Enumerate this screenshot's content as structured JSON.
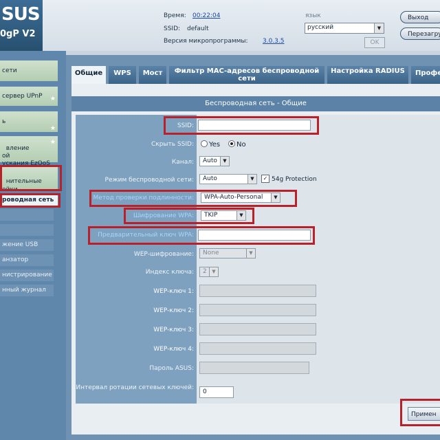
{
  "header": {
    "logo_text": "SUS",
    "model": "0gP V2",
    "time_label": "Время:",
    "time_value": "00:22:04",
    "ssid_label": "SSID:",
    "ssid_value": "default",
    "firmware_label": "Версия микропрограммы:",
    "firmware_value": "3.0.3.5",
    "language_label": "язык",
    "language_value": "русский",
    "ok_label": "OK",
    "logout_label": "Выход",
    "reboot_label": "Перезагрузка"
  },
  "nav": {
    "items": [
      {
        "label": "сети"
      },
      {
        "label": "сервер UPnP"
      },
      {
        "label": "ь"
      },
      {
        "label": "вление\nой\nускания EzQoS"
      },
      {
        "label": "нительные\nойки"
      },
      {
        "label": "роводная сеть"
      }
    ],
    "subitems": [
      {
        "label": "жение USB"
      },
      {
        "label": "анзатор"
      },
      {
        "label": "нистрирование"
      },
      {
        "label": "нный журнал"
      }
    ]
  },
  "tabs": [
    {
      "label": "Общие"
    },
    {
      "label": "WPS"
    },
    {
      "label": "Мост"
    },
    {
      "label": "Фильтр MAC-адресов беспроводной сети"
    },
    {
      "label": "Настройка RADIUS"
    },
    {
      "label": "Профе"
    }
  ],
  "panel": {
    "title": "Беспроводная сеть - Общие",
    "ssid_label": "SSID:",
    "ssid_value": "",
    "hide_ssid_label": "Скрыть SSID:",
    "hide_yes": "Yes",
    "hide_no": "No",
    "channel_label": "Канал:",
    "channel_value": "Auto",
    "mode_label": "Режим беспроводной сети:",
    "mode_value": "Auto",
    "protection_label": "54g Protection",
    "auth_label": "Метод проверки подлинности:",
    "auth_value": "WPA-Auto-Personal",
    "wpa_enc_label": "Шифрование WPA:",
    "wpa_enc_value": "TKIP",
    "psk_label": "Предварительный ключ WPA:",
    "psk_value": "",
    "wep_enc_label": "WEP-шифрование:",
    "wep_enc_value": "None",
    "key_index_label": "Индекс ключа:",
    "key_index_value": "2",
    "wep1_label": "WEP-ключ 1:",
    "wep2_label": "WEP-ключ 2:",
    "wep3_label": "WEP-ключ 3:",
    "wep4_label": "WEP-ключ 4:",
    "asus_pass_label": "Пароль ASUS:",
    "rotation_label": "Интервал ротации сетевых ключей:",
    "rotation_value": "0",
    "apply_label": "Примен"
  },
  "colors": {
    "highlight": "#b8202a",
    "tab_active": "#eef3f7",
    "nav_bg": "#5f87ab"
  }
}
